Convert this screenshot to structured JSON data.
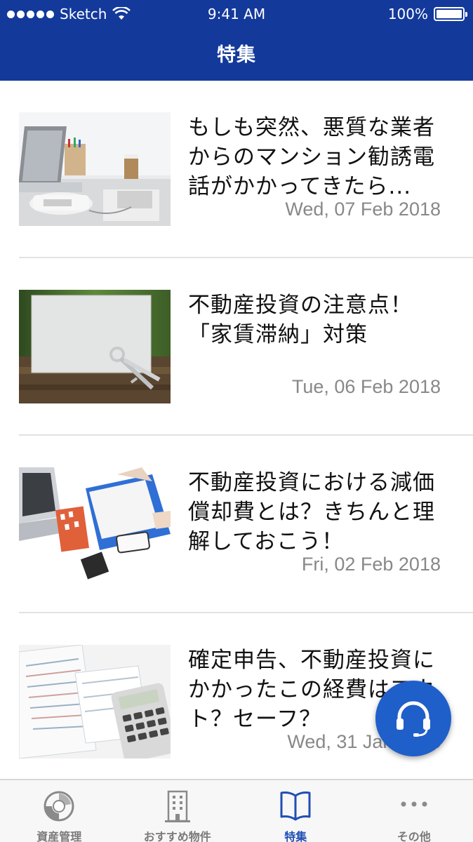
{
  "status_bar": {
    "carrier": "Sketch",
    "time": "9:41 AM",
    "battery": "100%"
  },
  "nav": {
    "title": "特集"
  },
  "articles": [
    {
      "title": "もしも突然、悪質な業者からのマンション勧誘電話がかかってきたら...",
      "date": "Wed, 07 Feb 2018",
      "image": "office-phone-desk"
    },
    {
      "title": "不動産投資の注意点！「家賃滞納」対策",
      "date": "Tue, 06 Feb 2018",
      "image": "keys-and-card"
    },
    {
      "title": "不動産投資における減価償却費とは？きちんと理解しておこう！",
      "date": "Fri, 02 Feb 2018",
      "image": "laptop-documents-building"
    },
    {
      "title": "確定申告、不動産投資にかかったこの経費はアウト？セーフ？",
      "date": "Wed, 31 Jan 2018",
      "image": "tax-forms-calculator"
    }
  ],
  "fab": {
    "icon": "headset-icon"
  },
  "tabs": [
    {
      "label": "資産管理",
      "icon": "asset-chart-icon",
      "active": false
    },
    {
      "label": "おすすめ物件",
      "icon": "building-icon",
      "active": false
    },
    {
      "label": "特集",
      "icon": "book-icon",
      "active": true
    },
    {
      "label": "その他",
      "icon": "more-icon",
      "active": false
    }
  ],
  "colors": {
    "header_bg": "#13399b",
    "accent": "#1f4fb3",
    "fab_bg": "#1f5fc9",
    "date_text": "#888888"
  }
}
